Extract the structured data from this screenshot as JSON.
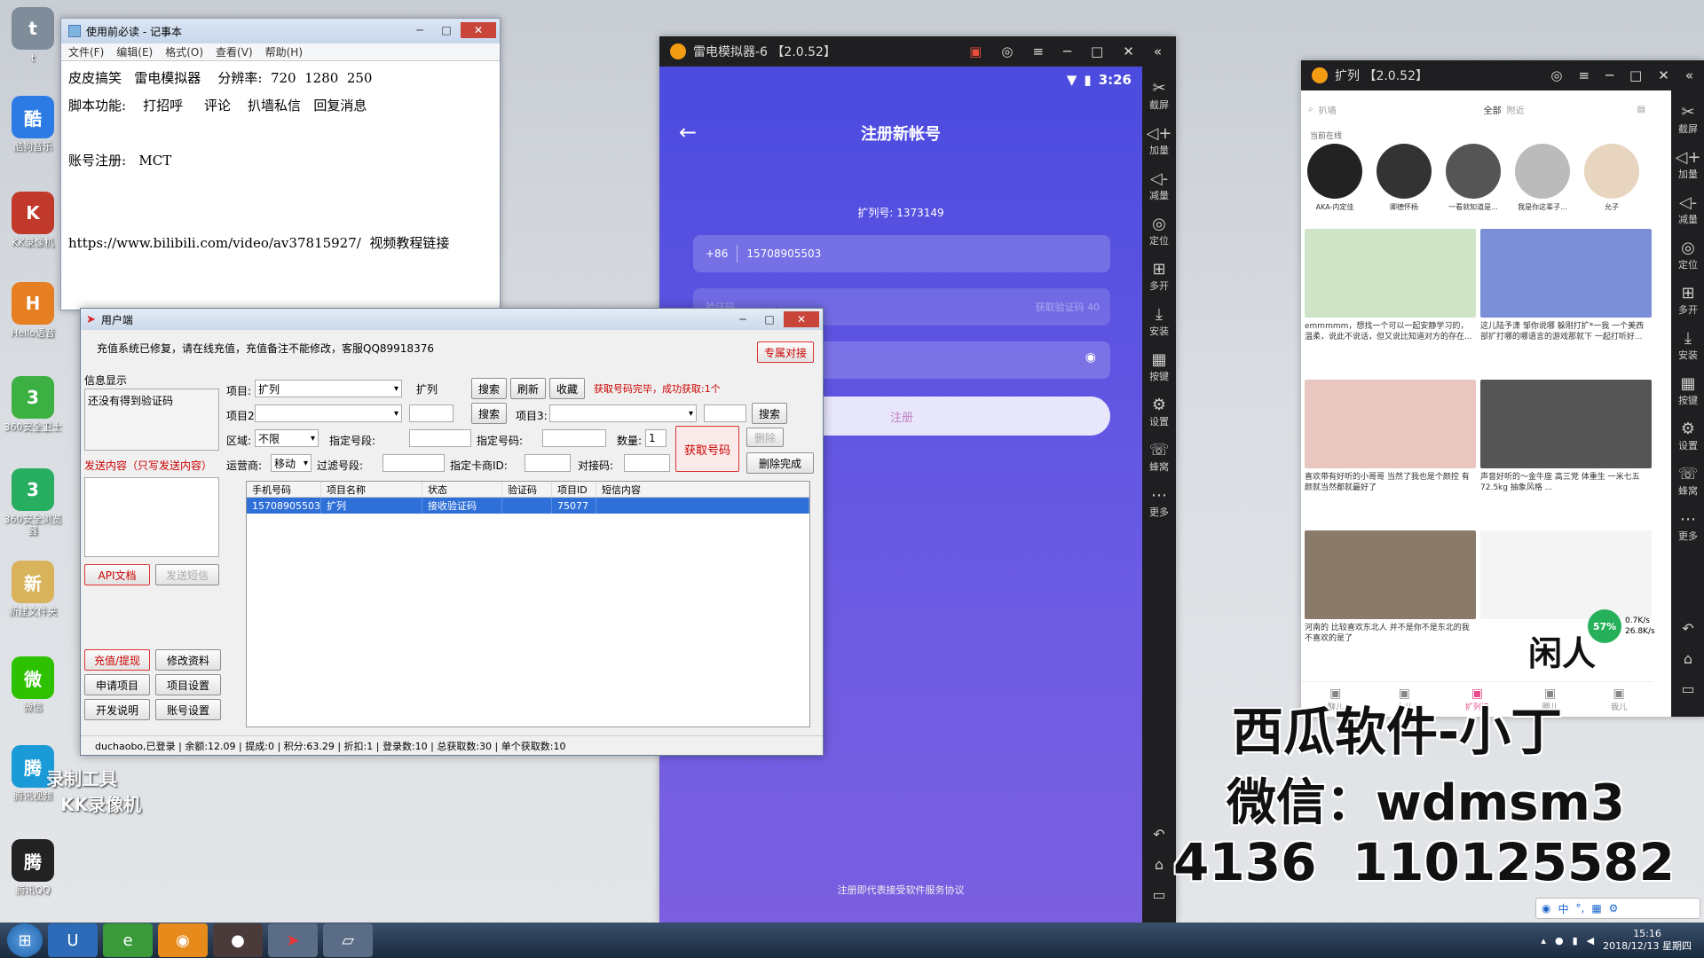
{
  "desktop_icons": [
    {
      "label": "t",
      "icon": "settings-icon",
      "color": "#7f8c9a"
    },
    {
      "label": "酷狗音乐",
      "icon": "kugou-icon",
      "color": "#2c7be5"
    },
    {
      "label": "KK录像机",
      "icon": "kk-recorder-icon",
      "color": "#c0392b"
    },
    {
      "label": "Hello语音",
      "icon": "apk-icon",
      "color": "#e67e22"
    },
    {
      "label": "360安全卫士",
      "icon": "360-safe-icon",
      "color": "#3cb043"
    },
    {
      "label": "360安全浏览器",
      "icon": "360-browser-icon",
      "color": "#27ae60"
    },
    {
      "label": "新建文件夹",
      "icon": "folder-icon",
      "color": "#d9b35b"
    },
    {
      "label": "微信",
      "icon": "wechat-icon",
      "color": "#2dc100"
    },
    {
      "label": "腾讯视频",
      "icon": "tencent-video-icon",
      "color": "#1a9bd7"
    },
    {
      "label": "腾讯QQ",
      "icon": "qq-icon",
      "color": "#222222"
    }
  ],
  "desktop_overlay": {
    "line1": "录制工具",
    "line2": "KK录像机"
  },
  "notepad": {
    "title": "使用前必读 - 记事本",
    "menu": [
      "文件(F)",
      "编辑(E)",
      "格式(O)",
      "查看(V)",
      "帮助(H)"
    ],
    "lines": [
      "皮皮搞笑   雷电模拟器    分辨率:  720  1280  250",
      "脚本功能:    打招呼     评论    扒墙私信   回复消息",
      "",
      "账号注册:   MCT",
      "",
      "",
      "https://www.bilibili.com/video/av37815927/  视频教程链接"
    ]
  },
  "client": {
    "title": "用户端",
    "notice": "充值系统已修复，请在线充值，充值备注不能修改，客服QQ89918376",
    "special_btn": "专属对接",
    "info_label": "信息显示",
    "info_text": "还没有得到验证码",
    "send_label": "发送内容（只写发送内容）",
    "api_doc": "API文档",
    "send_sms": "发送短信",
    "project_label": "项目:",
    "project_value": "扩列",
    "project_text": "扩列",
    "search": "搜索",
    "refresh": "刷新",
    "favorite": "收藏",
    "status_msg": "获取号码完毕，成功获取:1个",
    "project2_label": "项目2:",
    "project3_label": "项目3:",
    "region_label": "区域:",
    "region_value": "不限",
    "segment_label": "指定号段:",
    "number_label": "指定号码:",
    "qty_label": "数量:",
    "qty_value": "1",
    "get_number": "获取号码",
    "delete": "删除",
    "carrier_label": "运营商:",
    "carrier_value": "移动",
    "filter_label": "过滤号段:",
    "card_label": "指定卡商ID:",
    "dock_label": "对接码:",
    "delete_done": "删除完成",
    "columns": [
      "手机号码",
      "项目名称",
      "状态",
      "验证码",
      "项目ID",
      "短信内容"
    ],
    "rows": [
      [
        "15708905503",
        "扩列",
        "接收验证码",
        "",
        "75077",
        ""
      ]
    ],
    "left_buttons": [
      "充值/提现",
      "修改资料",
      "申请项目",
      "项目设置",
      "开发说明",
      "账号设置"
    ],
    "status_bar": "duchaobo,已登录 | 余额:12.09 | 提成:0 | 积分:63.29 | 折扣:1 | 登录数:10 | 总获取数:30 | 单个获取数:10"
  },
  "emu1": {
    "title": "雷电模拟器-6 【2.0.52】",
    "time": "3:26",
    "page_title": "注册新帐号",
    "kuolie_id": "扩列号: 1373149",
    "country_code": "+86",
    "phone": "15708905503",
    "code_placeholder": "验证码",
    "code_btn": "获取验证码 40",
    "register": "注册",
    "agreement": "注册即代表接受软件服务协议",
    "side": [
      "截屏",
      "加量",
      "减量",
      "定位",
      "多开",
      "安装",
      "按键",
      "设置",
      "蜂窝",
      "更多"
    ]
  },
  "emu2": {
    "title": "扩列 【2.0.52】",
    "search_hint": "扒墙",
    "filter": "全部",
    "filter2": "附近",
    "online_label": "当前在线",
    "avatars": [
      "AKA-内定佳",
      "卿德怀杨",
      "一看就知道是...",
      "我是你这辈子...",
      "允子"
    ],
    "cards": [
      "emmmmm，想找一个可以一起安静学习的，温柔，说此不说话，但又说比知道对方的存在...",
      "这儿陆予潇 邹你说哪 躲刚打扩*一我 一个美西部扩打哪的哪语言的游戏那就下 一起打听好...",
      "喜欢带有好听的小哥哥 当然了我也是个颜控 有颜就当然都就最好了",
      "声音好听的～金牛座 高三党 体重生 一米七五 72.5kg 抽象风格 ...",
      "河南的 比较喜欢东北人 并不是你不是东北的我不喜欢的是了",
      ""
    ],
    "nav": [
      "聊儿",
      "人儿",
      "扩列墙",
      "圈儿",
      "我儿"
    ],
    "net_percent": "57%",
    "net_up": "0.7K/s",
    "net_down": "26.8K/s",
    "side": [
      "截屏",
      "加量",
      "减量",
      "定位",
      "多开",
      "安装",
      "按键",
      "设置",
      "蜂窝",
      "更多"
    ]
  },
  "watermark": {
    "line1": "西瓜软件-小丁",
    "line2": "微信：wdmsm3",
    "line3": "4136  110125582",
    "partial": "闲人"
  },
  "taskbar": {
    "clock_time": "15:16",
    "clock_date": "2018/12/13 星期四",
    "ime": "中"
  }
}
